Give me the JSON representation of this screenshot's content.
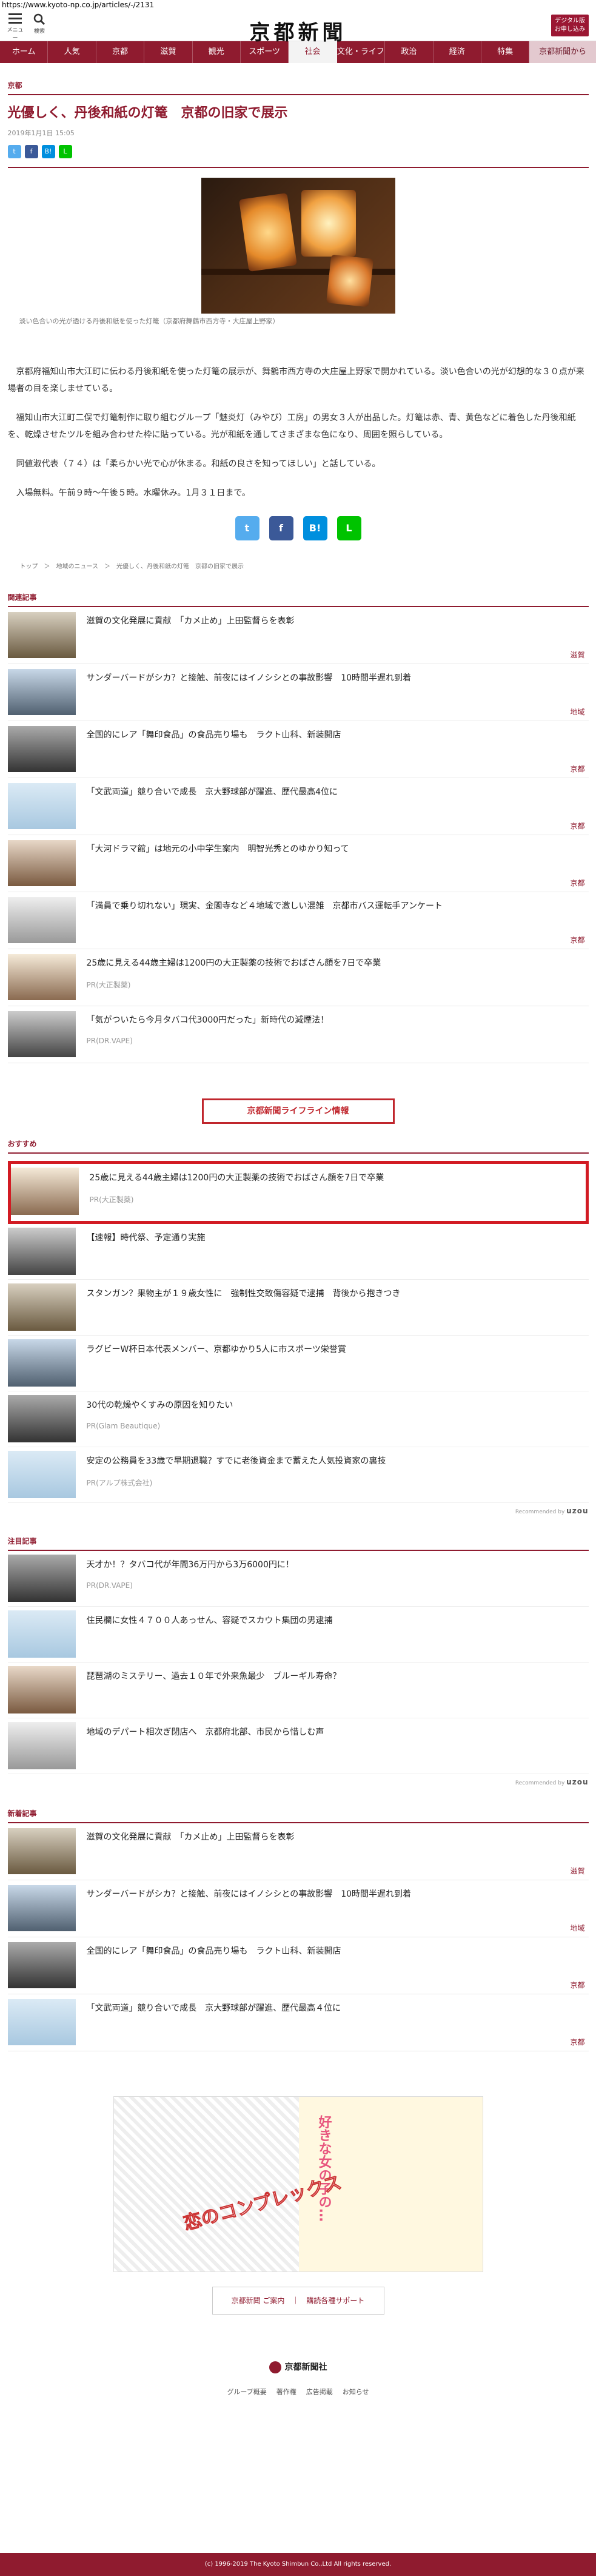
{
  "browser": {
    "url": "https://www.kyoto-np.co.jp/articles/-/2131"
  },
  "header": {
    "menu_label": "メニュー",
    "search_label": "検索",
    "logo": "京都新聞",
    "digital_button": "デジタル版\nお申し込み"
  },
  "nav": [
    "ホーム",
    "人気",
    "京都",
    "滋賀",
    "観光",
    "スポーツ",
    "社会",
    "文化・ライフ",
    "政治",
    "経済",
    "特集",
    "京都新聞から"
  ],
  "article": {
    "category": "京都",
    "title": "光優しく、丹後和紙の灯篭　京都の旧家で展示",
    "date": "2019年1月1日 15:05",
    "caption": "淡い色合いの光が透ける丹後和紙を使った灯篭（京都府舞鶴市西方寺・大庄屋上野家）",
    "paragraphs": [
      "京都府福知山市大江町に伝わる丹後和紙を使った灯篭の展示が、舞鶴市西方寺の大庄屋上野家で開かれている。淡い色合いの光が幻想的な３０点が来場者の目を楽しませている。",
      "福知山市大江町二俣で灯篭制作に取り組むグループ「魅炎灯（みやび）工房」の男女３人が出品した。灯篭は赤、青、黄色などに着色した丹後和紙を、乾燥させたツルを組み合わせた枠に貼っている。光が和紙を通してさまざまな色になり、周囲を照らしている。",
      "同値淑代表（７４）は「柔らかい光で心が休まる。和紙の良さを知ってほしい」と話している。",
      "入場無料。午前９時～午後５時。水曜休み。1月３１日まで。"
    ],
    "share_small": [
      "t",
      "f",
      "B!",
      "L"
    ],
    "share_big": [
      "t",
      "f",
      "B!",
      "L"
    ],
    "breadcrumb": "トップ　＞　地域のニュース　＞　光優しく、丹後和紙の灯篭　京都の旧家で展示"
  },
  "related": {
    "heading": "関連記事",
    "items": [
      {
        "title": "滋賀の文化発展に貢献　「カメ止め」上田監督らを表彰",
        "tag": "滋賀",
        "pr": ""
      },
      {
        "title": "サンダーバードがシカ？と接触、前夜にはイノシシとの事故影響　10時間半遅れ到着",
        "tag": "地域",
        "pr": ""
      },
      {
        "title": "全国的にレア「舞印食品」の食品売り場も　ラクト山科、新装開店",
        "tag": "京都",
        "pr": ""
      },
      {
        "title": "「文武両道」競り合いで成長　京大野球部が躍進、歴代最高4位に",
        "tag": "京都",
        "pr": ""
      },
      {
        "title": "「大河ドラマ館」は地元の小中学生案内　明智光秀とのゆかり知って",
        "tag": "京都",
        "pr": ""
      },
      {
        "title": "「満員で乗り切れない」現実、金閣寺など４地域で激しい混雑　京都市バス運転手アンケート",
        "tag": "京都",
        "pr": ""
      },
      {
        "title": "25歳に見える44歳主婦は1200円の大正製薬の技術でおばさん顔を7日で卒業",
        "tag": "",
        "pr": "PR(大正製薬)"
      },
      {
        "title": "「気がついたら今月タバコ代3000円だった」新時代の減煙法！",
        "tag": "",
        "pr": "PR(DR.VAPE)"
      }
    ]
  },
  "lifeline_button": "京都新聞ライフライン情報",
  "recommend": {
    "heading": "おすすめ",
    "items": [
      {
        "title": "25歳に見える44歳主婦は1200円の大正製薬の技術でおばさん顔を7日で卒業",
        "pr": "PR(大正製薬)"
      },
      {
        "title": "【速報】時代祭、予定通り実施",
        "pr": ""
      },
      {
        "title": "スタンガン？果物主が１９歳女性に　強制性交致傷容疑で逮捕　背後から抱きつき",
        "pr": ""
      },
      {
        "title": "ラグビーW杯日本代表メンバー、京都ゆかり5人に市スポーツ栄誉賞",
        "pr": ""
      },
      {
        "title": "30代の乾燥やくすみの原因を知りたい",
        "pr": "PR(Glam Beautique)"
      },
      {
        "title": "安定の公務員を33歳で早期退職？すでに老後資金まで蓄えた人気投資家の裏技",
        "pr": "PR(アルプ株式会社)"
      }
    ],
    "recommended_by": "Recommended by",
    "brand": "uzou"
  },
  "attention": {
    "heading": "注目記事",
    "items": [
      {
        "title": "天才か！？タバコ代が年間36万円から3万6000円に！",
        "pr": "PR(DR.VAPE)"
      },
      {
        "title": "住民欄に女性４７００人あっせん、容疑でスカウト集団の男逮捕",
        "pr": ""
      },
      {
        "title": "琵琶湖のミステリー、過去１０年で外来魚最少　ブルーギル寿命？",
        "pr": ""
      },
      {
        "title": "地域のデパート相次ぎ閉店へ　京都府北部、市民から惜しむ声",
        "pr": ""
      }
    ],
    "recommended_by": "Recommended by",
    "brand": "uzou"
  },
  "newest": {
    "heading": "新着記事",
    "items": [
      {
        "title": "滋賀の文化発展に貢献　「カメ止め」上田監督らを表彰",
        "tag": "滋賀"
      },
      {
        "title": "サンダーバードがシカ？と接触、前夜にはイノシシとの事故影響　10時間半遅れ到着",
        "tag": "地域"
      },
      {
        "title": "全国的にレア「舞印食品」の食品売り場も　ラクト山科、新装開店",
        "tag": "京都"
      },
      {
        "title": "「文武両道」競り合いで成長　京大野球部が躍進、歴代最高４位に",
        "tag": "京都"
      }
    ]
  },
  "ad": {
    "vertical_text": "好きな女の子の…",
    "stamp_text": "恋のコンプレックス"
  },
  "support_box": "京都新聞 ご案内　｜　購読各種サポート",
  "footer": {
    "logo_text": "京都新聞社",
    "links": [
      "グループ概要",
      "著作権",
      "広告掲載",
      "お知らせ"
    ],
    "copyright": "(c) 1996-2019 The Kyoto Shimbun Co.,Ltd All rights reserved."
  },
  "colors": {
    "brand": "#8f1b2f",
    "highlight_border": "#d21b23"
  }
}
